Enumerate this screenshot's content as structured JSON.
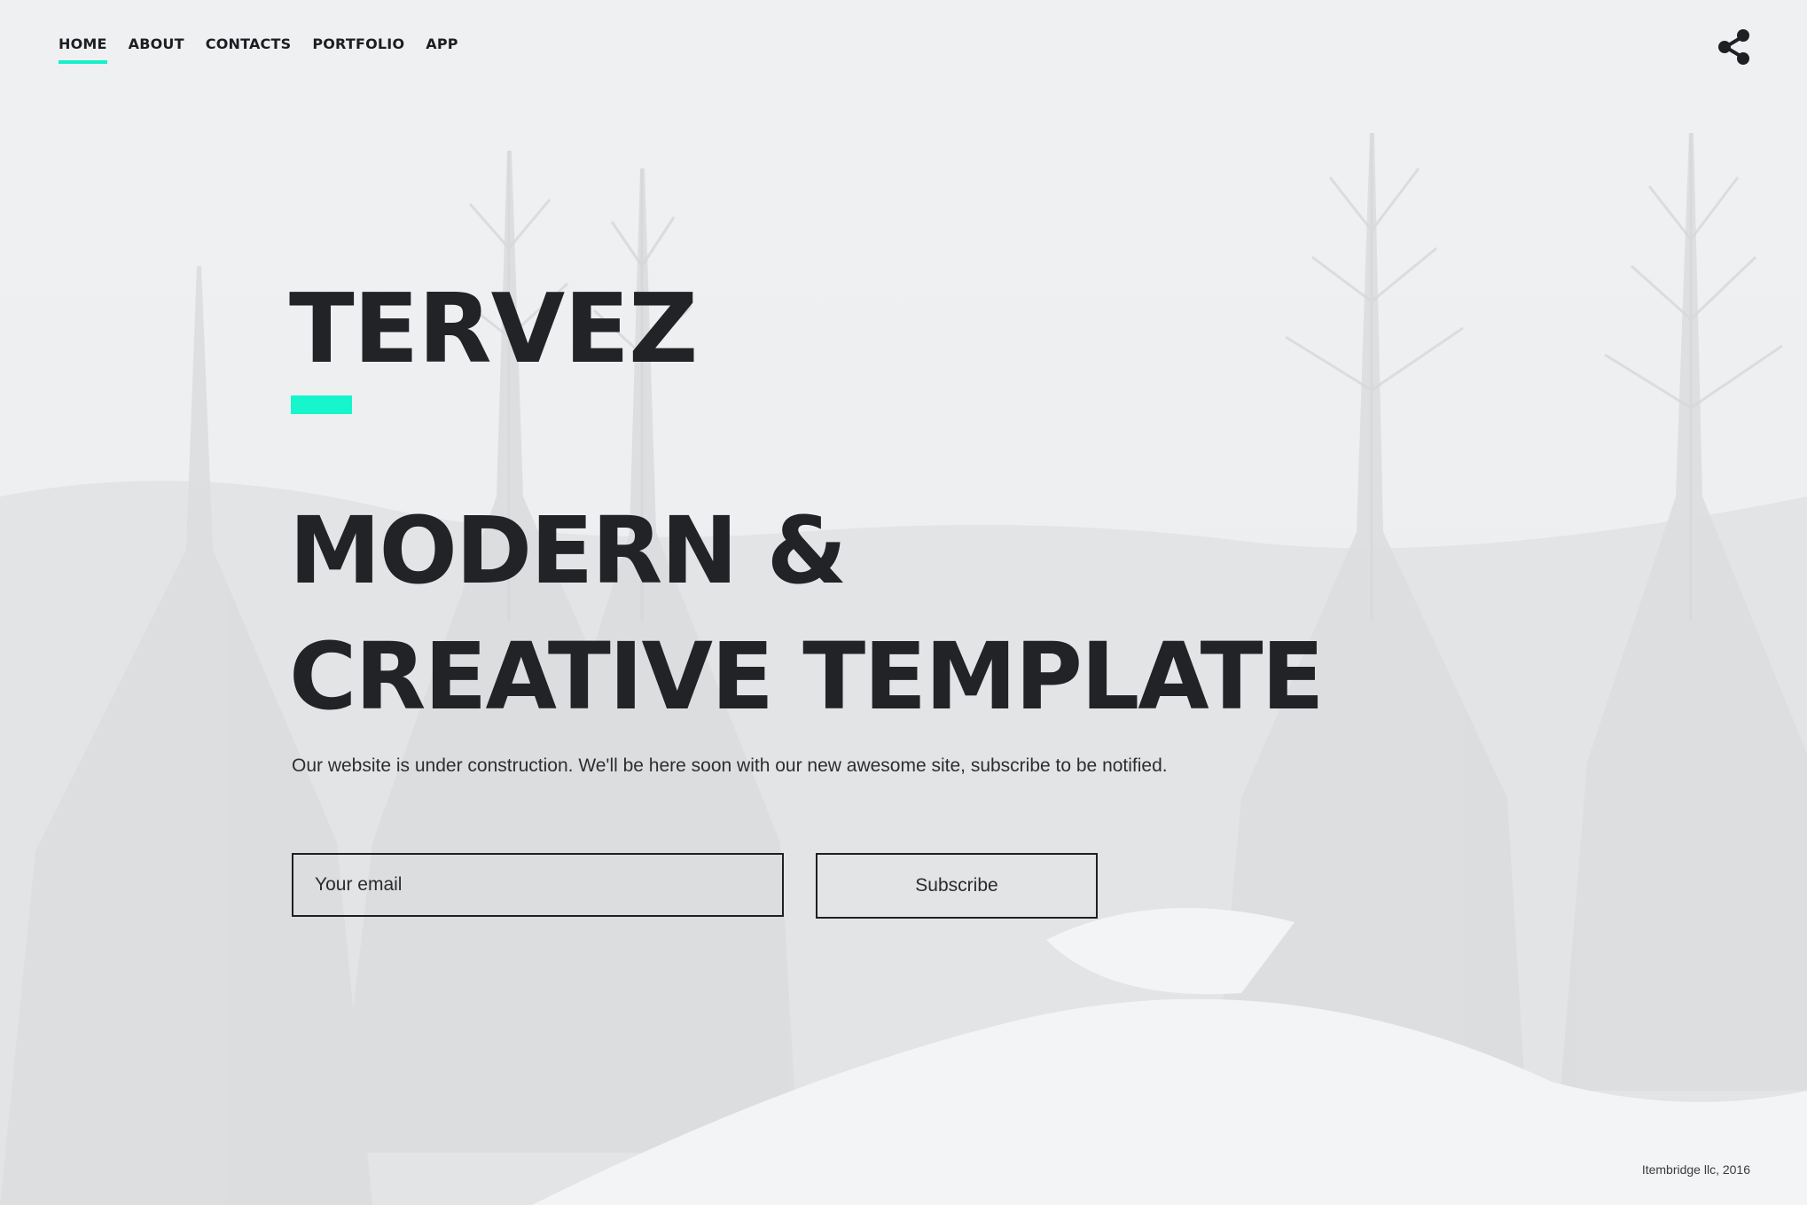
{
  "nav": {
    "items": [
      {
        "label": "HOME",
        "active": true
      },
      {
        "label": "ABOUT",
        "active": false
      },
      {
        "label": "CONTACTS",
        "active": false
      },
      {
        "label": "PORTFOLIO",
        "active": false
      },
      {
        "label": "APP",
        "active": false
      }
    ],
    "share_icon": "share-icon"
  },
  "hero": {
    "brand": "TERVEZ",
    "headline_line1": "MODERN &",
    "headline_line2": "CREATIVE TEMPLATE",
    "tagline": "Our website is under construction. We'll be here soon with our new awesome site, subscribe to be notified."
  },
  "subscribe_form": {
    "email_placeholder": "Your email",
    "email_value": "",
    "button_label": "Subscribe"
  },
  "footer": {
    "copyright": "Itembridge llc, 2016"
  },
  "colors": {
    "accent": "#16f5cc",
    "text": "#222326",
    "background": "#eeeff1"
  }
}
